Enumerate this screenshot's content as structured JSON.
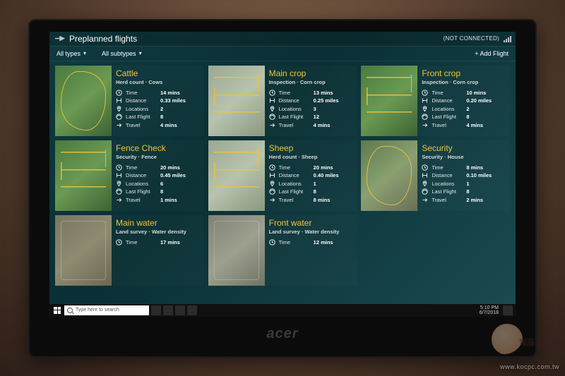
{
  "app_title": "Preplanned flights",
  "connection_status": "(NOT CONNECTED)",
  "filters": {
    "type_label": "All types",
    "subtype_label": "All subtypes"
  },
  "add_flight_label": "+ Add Flight",
  "stat_labels": {
    "time": "Time",
    "distance": "Distance",
    "locations": "Locations",
    "last_flight": "Last Flight",
    "travel": "Travel"
  },
  "cards": [
    {
      "title": "Cattle",
      "subtitle": "Herd count · Cows",
      "time": "14 mins",
      "distance": "0.33 miles",
      "locations": "2",
      "last_flight": "8",
      "travel": "4 mins",
      "thumb": "green",
      "path": "blob"
    },
    {
      "title": "Main crop",
      "subtitle": "Inspection · Corn crop",
      "time": "13 mins",
      "distance": "0.25 miles",
      "locations": "3",
      "last_flight": "12",
      "travel": "4 mins",
      "thumb": "pale",
      "path": "zig"
    },
    {
      "title": "Front crop",
      "subtitle": "Inspection · Corn crop",
      "time": "10 mins",
      "distance": "0.20 miles",
      "locations": "2",
      "last_flight": "8",
      "travel": "4 mins",
      "thumb": "green",
      "path": "zig"
    },
    {
      "title": "Fence Check",
      "subtitle": "Security · Fence",
      "time": "20 mins",
      "distance": "0.45 miles",
      "locations": "6",
      "last_flight": "8",
      "travel": "1 mins",
      "thumb": "green",
      "path": "zig"
    },
    {
      "title": "Sheep",
      "subtitle": "Herd count · Sheep",
      "time": "20 mins",
      "distance": "0.40 miles",
      "locations": "1",
      "last_flight": "8",
      "travel": "8 mins",
      "thumb": "pale",
      "path": "zig"
    },
    {
      "title": "Security",
      "subtitle": "Security · House",
      "time": "8 mins",
      "distance": "0.10 miles",
      "locations": "1",
      "last_flight": "8",
      "travel": "2 mins",
      "thumb": "mix",
      "path": "blob"
    },
    {
      "title": "Main water",
      "subtitle": "Land survey · Water density",
      "time": "17 mins",
      "distance": "",
      "locations": "",
      "last_flight": "",
      "travel": "",
      "thumb": "dirt",
      "path": "faint"
    },
    {
      "title": "Front water",
      "subtitle": "Land survey · Water density",
      "time": "12 mins",
      "distance": "",
      "locations": "",
      "last_flight": "",
      "travel": "",
      "thumb": "gray",
      "path": "faint"
    }
  ],
  "taskbar": {
    "search_placeholder": "Type here to search",
    "time": "5:10 PM",
    "date": "6/7/2018"
  },
  "watermarks": {
    "url": "www.kocpc.com.tw",
    "brand": "電腦王阿達"
  }
}
